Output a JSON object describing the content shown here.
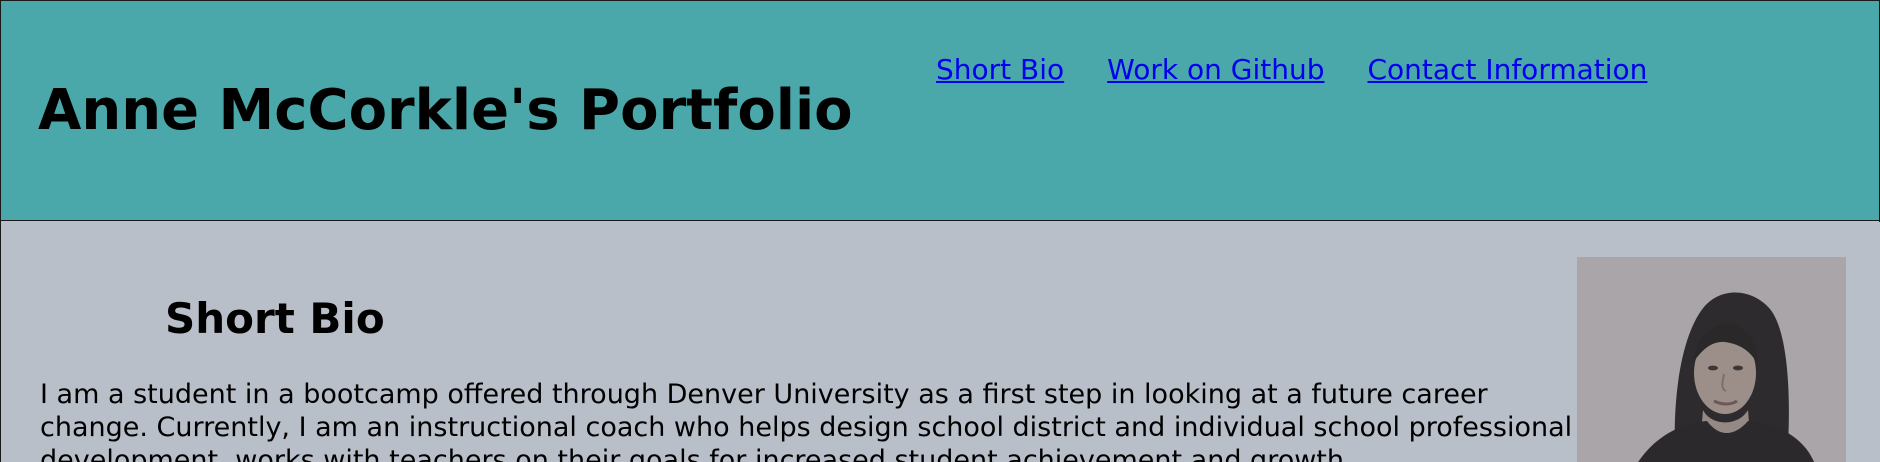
{
  "header": {
    "title": "Anne McCorkle's Portfolio",
    "nav": [
      {
        "label": "Short Bio"
      },
      {
        "label": "Work on Github"
      },
      {
        "label": "Contact Information"
      }
    ]
  },
  "main": {
    "section_heading": "Short Bio",
    "bio_paragraph": "I am a student in a bootcamp offered through Denver University as a first step in looking at a future career change. Currently, I am an instructional coach who helps design school district and individual school professional development, works with teachers on their goals for increased student achievement and growth"
  },
  "colors": {
    "header_bg": "#4ba8aa",
    "page_bg": "#b9bfc9",
    "link": "#0000ee"
  }
}
